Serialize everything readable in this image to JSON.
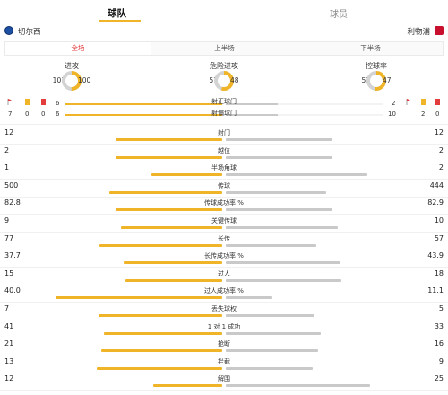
{
  "tabs": {
    "team": "球队",
    "player": "球员"
  },
  "teams": {
    "home": "切尔西",
    "away": "利物浦"
  },
  "periods": [
    "全场",
    "上半场",
    "下半场"
  ],
  "colors": {
    "home": "#f0b429",
    "away": "#c9c9c9",
    "active_period": "#e23c3c"
  },
  "summary": [
    {
      "label": "进攻",
      "home": "101",
      "away": "100",
      "home_share": 0.502
    },
    {
      "label": "危险进攻",
      "home": "57",
      "away": "48",
      "home_share": 0.543
    },
    {
      "label": "控球率",
      "home": "53",
      "away": "47",
      "home_share": 0.53
    }
  ],
  "shots": {
    "on_target": {
      "label": "射正球门",
      "home": "6",
      "away": "2"
    },
    "off_target": {
      "label": "射偏球门",
      "home": "6",
      "away": "2"
    },
    "home_cards": {
      "corners": "7",
      "yellow": "0",
      "red": "0"
    },
    "away_cards": {
      "corners": "10",
      "yellow": "2",
      "red": "0"
    }
  },
  "stats": [
    {
      "label": "射门",
      "home": "12",
      "away": "12",
      "home_share": 0.5
    },
    {
      "label": "越位",
      "home": "2",
      "away": "2",
      "home_share": 0.5
    },
    {
      "label": "半场角球",
      "home": "1",
      "away": "2",
      "home_share": 0.333
    },
    {
      "label": "传球",
      "home": "500",
      "away": "444",
      "home_share": 0.53
    },
    {
      "label": "传球成功率 %",
      "home": "82.8",
      "away": "82.9",
      "home_share": 0.5
    },
    {
      "label": "关键传球",
      "home": "9",
      "away": "10",
      "home_share": 0.474
    },
    {
      "label": "长传",
      "home": "77",
      "away": "57",
      "home_share": 0.575
    },
    {
      "label": "长传成功率 %",
      "home": "37.7",
      "away": "43.9",
      "home_share": 0.462
    },
    {
      "label": "过人",
      "home": "15",
      "away": "18",
      "home_share": 0.455
    },
    {
      "label": "过人成功率 %",
      "home": "40.0",
      "away": "11.1",
      "home_share": 0.783
    },
    {
      "label": "丢失球权",
      "home": "7",
      "away": "5",
      "home_share": 0.583
    },
    {
      "label": "1 对 1 成功",
      "home": "41",
      "away": "33",
      "home_share": 0.554
    },
    {
      "label": "抢断",
      "home": "21",
      "away": "16",
      "home_share": 0.568
    },
    {
      "label": "拦截",
      "home": "13",
      "away": "9",
      "home_share": 0.591
    },
    {
      "label": "解围",
      "home": "12",
      "away": "25",
      "home_share": 0.324
    }
  ]
}
